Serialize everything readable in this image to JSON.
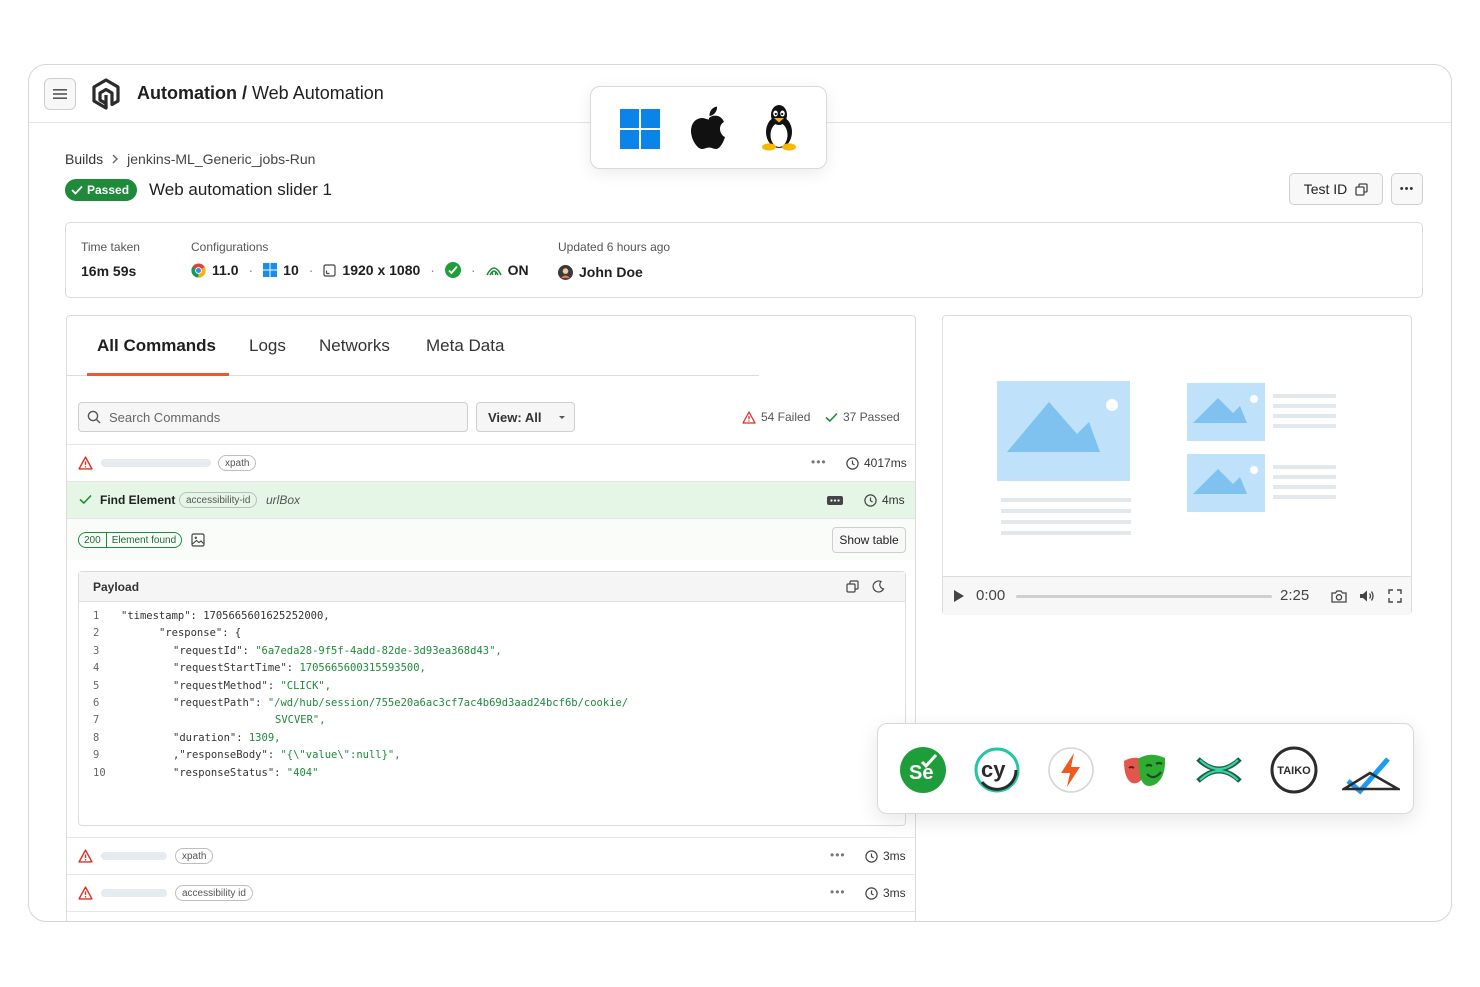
{
  "header": {
    "title_bold": "Automation /",
    "title_rest": " Web Automation"
  },
  "breadcrumb": {
    "root": "Builds",
    "current": "jenkins-ML_Generic_jobs-Run"
  },
  "test": {
    "status": "Passed",
    "title": "Web automation slider 1",
    "test_id_label": "Test ID",
    "more_label": "•••"
  },
  "info": {
    "time_label": "Time taken",
    "time_value": "16m 59s",
    "config_label": "Configurations",
    "browser_version": "11.0",
    "os_version": "10",
    "resolution": "1920 x 1080",
    "tunnel": "ON",
    "sep": "·",
    "updated_label": "Updated 6 hours ago",
    "user": "John Doe"
  },
  "tabs": [
    "All Commands",
    "Logs",
    "Networks",
    "Meta Data"
  ],
  "search": {
    "placeholder": "Search Commands"
  },
  "view": {
    "label": "View: All"
  },
  "stats": {
    "failed": "54 Failed",
    "passed": "37 Passed"
  },
  "commands": [
    {
      "locator": "xpath",
      "duration": "4017ms",
      "status": "failed"
    },
    {
      "name": "Find Element",
      "locator": "accessibility-id",
      "target": "urlBox",
      "duration": "4ms",
      "status": "passed"
    },
    {
      "locator": "xpath",
      "duration": "3ms",
      "status": "failed"
    },
    {
      "locator": "accessibility id",
      "duration": "3ms",
      "status": "failed"
    }
  ],
  "detail": {
    "code": "200",
    "message": "Element found",
    "show_table": "Show table"
  },
  "payload": {
    "title": "Payload",
    "lines": [
      {
        "n": "1",
        "key": "\"timestamp\": ",
        "val": "1705665601625252000,",
        "indent": 0,
        "str": false
      },
      {
        "n": "2",
        "key": "\"response\": {",
        "val": "",
        "indent": 1,
        "str": false
      },
      {
        "n": "3",
        "key": "\"requestId\": ",
        "val": "\"6a7eda28-9f5f-4add-82de-3d93ea368d43\",",
        "indent": 2,
        "str": true
      },
      {
        "n": "4",
        "key": "\"requestStartTime\": ",
        "val": "1705665600315593500,",
        "indent": 2,
        "str": true
      },
      {
        "n": "5",
        "key": "\"requestMethod\": ",
        "val": "\"CLICK\",",
        "indent": 2,
        "str": true
      },
      {
        "n": "6",
        "key": "\"requestPath\": ",
        "val": "\"/wd/hub/session/755e20a6ac3cf7ac4b69d3aad24bcf6b/cookie/",
        "indent": 2,
        "str": true
      },
      {
        "n": "7",
        "key": "",
        "val": "SVCVER\",",
        "indent": 3,
        "str": true
      },
      {
        "n": "8",
        "key": "\"duration\": ",
        "val": "1309,",
        "indent": 2,
        "str": true
      },
      {
        "n": "9",
        "key": ",\"responseBody\": ",
        "val": "\"{\\\"value\\\":null}\",",
        "indent": 2,
        "str": true
      },
      {
        "n": "10",
        "key": "\"responseStatus\": ",
        "val": "\"404\"",
        "indent": 2,
        "str": true
      }
    ]
  },
  "video": {
    "current_time": "0:00",
    "total_time": "2:25",
    "progress": 0
  },
  "frameworks": {
    "selenium_label": "Se",
    "cypress_label": "cy",
    "taiko_label": "TAIKO"
  },
  "colors": {
    "accent": "#ea5a2e",
    "passed": "#1e8a3a",
    "failed": "#d93025",
    "placeholder_blue": "#bfe1fa"
  }
}
